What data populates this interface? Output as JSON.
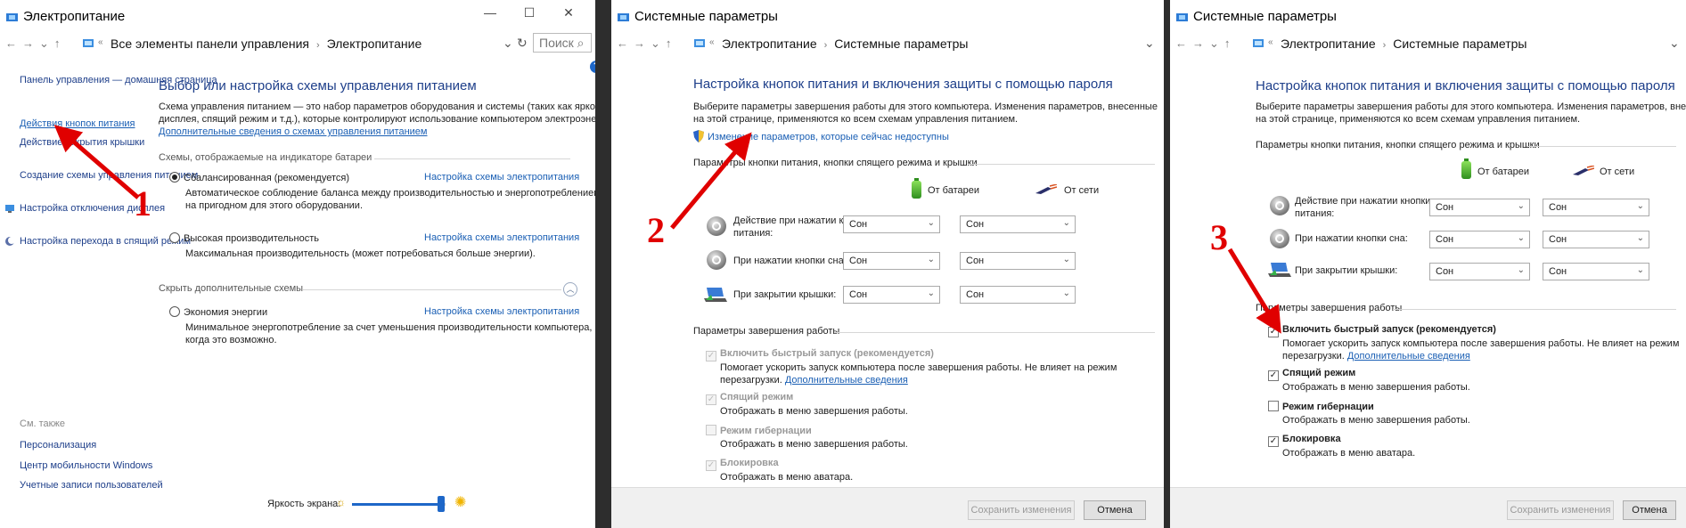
{
  "p1": {
    "title": "Электропитание",
    "breadcrumb": [
      "Все элементы панели управления",
      "Электропитание"
    ],
    "search_placeholder": "Поиск",
    "sidebar": [
      "Панель управления — домашняя страница",
      "Действия кнопок питания",
      "Действие закрытия крышки",
      "Создание схемы управления питанием",
      "Настройка отключения дисплея",
      "Настройка перехода в спящий режим"
    ],
    "heading": "Выбор или настройка схемы управления питанием",
    "intro": [
      "Схема управления питанием — это набор параметров оборудования и системы (таких как яркость",
      "дисплея, спящий режим и т.д.), которые контролируют использование компьютером электроэнергии."
    ],
    "intro_link": "Дополнительные сведения о схемах управления питанием",
    "section1": "Схемы, отображаемые на индикаторе батареи",
    "plans": [
      {
        "name": "Сбалансированная (рекомендуется)",
        "desc": [
          "Автоматическое соблюдение баланса между производительностью и энергопотреблением",
          "на пригодном для этого оборудовании."
        ],
        "link": "Настройка схемы электропитания",
        "selected": true
      },
      {
        "name": "Высокая производительность",
        "desc": [
          "Максимальная производительность (может потребоваться больше энергии)."
        ],
        "link": "Настройка схемы электропитания",
        "selected": false
      },
      {
        "name": "Экономия энергии",
        "desc": [
          "Минимальное энергопотребление за счет уменьшения производительности компьютера,",
          "когда это возможно."
        ],
        "link": "Настройка схемы электропитания",
        "selected": false
      }
    ],
    "section2": "Скрыть дополнительные схемы",
    "see_also": "См. также",
    "see_also_links": [
      "Персонализация",
      "Центр мобильности Windows",
      "Учетные записи пользователей"
    ],
    "brightness": "Яркость экрана:",
    "brightness_level": 0.95
  },
  "p2": {
    "title": "Системные параметры",
    "breadcrumb": [
      "Электропитание",
      "Системные параметры"
    ],
    "heading": "Настройка кнопок питания и включения защиты с помощью пароля",
    "intro": [
      "Выберите параметры завершения работы для этого компьютера. Изменения параметров, внесенные",
      "на этой странице, применяются ко всем схемам управления питанием."
    ],
    "unavail_link": "Изменение параметров, которые сейчас недоступны",
    "section1": "Параметры кнопки питания, кнопки спящего режима и крышки",
    "col_battery": "От батареи",
    "col_ac": "От сети",
    "rows": [
      {
        "label": [
          "Действие при нажатии кнопки",
          "питания:"
        ],
        "battery": "Сон",
        "ac": "Сон"
      },
      {
        "label": [
          "При нажатии кнопки сна:"
        ],
        "battery": "Сон",
        "ac": "Сон"
      },
      {
        "label": [
          "При закрытии крышки:"
        ],
        "battery": "Сон",
        "ac": "Сон"
      }
    ],
    "section2": "Параметры завершения работы",
    "options": [
      {
        "name": "Включить быстрый запуск (рекомендуется)",
        "desc1": "Помогает ускорить запуск компьютера после завершения работы. Не влияет на режим",
        "desc2": "перезагрузки.",
        "desc_link": "Дополнительные сведения",
        "checked": true
      },
      {
        "name": "Спящий режим",
        "desc1": "Отображать в меню завершения работы.",
        "checked": true
      },
      {
        "name": "Режим гибернации",
        "desc1": "Отображать в меню завершения работы.",
        "checked": false
      },
      {
        "name": "Блокировка",
        "desc1": "Отображать в меню аватара.",
        "checked": true
      }
    ],
    "save": "Сохранить изменения",
    "cancel": "Отмена",
    "check_mark": "✓"
  },
  "p3": {
    "title": "Системные параметры",
    "breadcrumb": [
      "Электропитание",
      "Системные параметры"
    ],
    "heading": "Настройка кнопок питания и включения защиты с помощью пароля",
    "intro": [
      "Выберите параметры завершения работы для этого компьютера. Изменения параметров, внесенные",
      "на этой странице, применяются ко всем схемам управления питанием."
    ],
    "section1": "Параметры кнопки питания, кнопки спящего режима и крышки",
    "col_battery": "От батареи",
    "col_ac": "От сети",
    "rows": [
      {
        "label": [
          "Действие при нажатии кнопки",
          "питания:"
        ],
        "battery": "Сон",
        "ac": "Сон"
      },
      {
        "label": [
          "При нажатии кнопки сна:"
        ],
        "battery": "Сон",
        "ac": "Сон"
      },
      {
        "label": [
          "При закрытии крышки:"
        ],
        "battery": "Сон",
        "ac": "Сон"
      }
    ],
    "section2": "Параметры завершения работы",
    "options": [
      {
        "name": "Включить быстрый запуск (рекомендуется)",
        "desc1": "Помогает ускорить запуск компьютера после завершения работы. Не влияет на режим",
        "desc2": "перезагрузки.",
        "desc_link": "Дополнительные сведения",
        "checked": true
      },
      {
        "name": "Спящий режим",
        "desc1": "Отображать в меню завершения работы.",
        "checked": true
      },
      {
        "name": "Режим гибернации",
        "desc1": "Отображать в меню завершения работы.",
        "checked": false
      },
      {
        "name": "Блокировка",
        "desc1": "Отображать в меню аватара.",
        "checked": true
      }
    ],
    "save": "Сохранить изменения",
    "cancel": "Отмена",
    "check_mark": "✓"
  },
  "annotations": {
    "n1": "1",
    "n2": "2",
    "n3": "3"
  },
  "colors": {
    "arrow": "#e00000",
    "link": "#1a5fb4",
    "heading": "#1e3f8a"
  }
}
